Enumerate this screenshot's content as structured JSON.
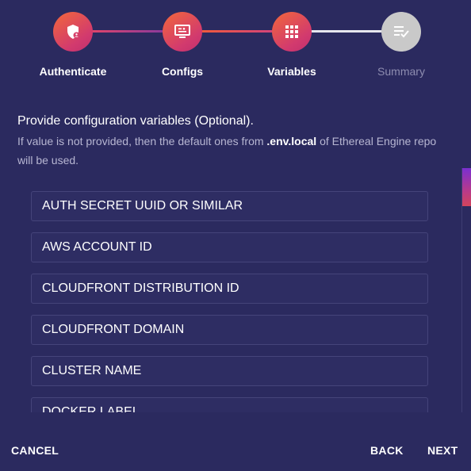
{
  "stepper": {
    "steps": [
      {
        "label": "Authenticate",
        "icon": "shield-user-icon",
        "state": "complete"
      },
      {
        "label": "Configs",
        "icon": "monitor-settings-icon",
        "state": "complete"
      },
      {
        "label": "Variables",
        "icon": "grid-icon",
        "state": "active"
      },
      {
        "label": "Summary",
        "icon": "checklist-icon",
        "state": "pending"
      }
    ]
  },
  "content": {
    "heading": "Provide configuration variables (Optional).",
    "description_prefix": "If value is not provided, then the default ones from ",
    "description_highlight": ".env.local",
    "description_suffix": " of Ethereal Engine repo will be used."
  },
  "fields": [
    {
      "placeholder": "AUTH SECRET UUID OR SIMILAR",
      "value": ""
    },
    {
      "placeholder": "AWS ACCOUNT ID",
      "value": ""
    },
    {
      "placeholder": "CLOUDFRONT DISTRIBUTION ID",
      "value": ""
    },
    {
      "placeholder": "CLOUDFRONT DOMAIN",
      "value": ""
    },
    {
      "placeholder": "CLUSTER NAME",
      "value": ""
    },
    {
      "placeholder": "DOCKER LABEL",
      "value": ""
    }
  ],
  "footer": {
    "cancel_label": "CANCEL",
    "back_label": "BACK",
    "next_label": "NEXT"
  },
  "colors": {
    "background": "#2b2a5f",
    "accent_start": "#f2683a",
    "accent_end": "#c0306e",
    "inactive_step": "#c9c9c9"
  }
}
